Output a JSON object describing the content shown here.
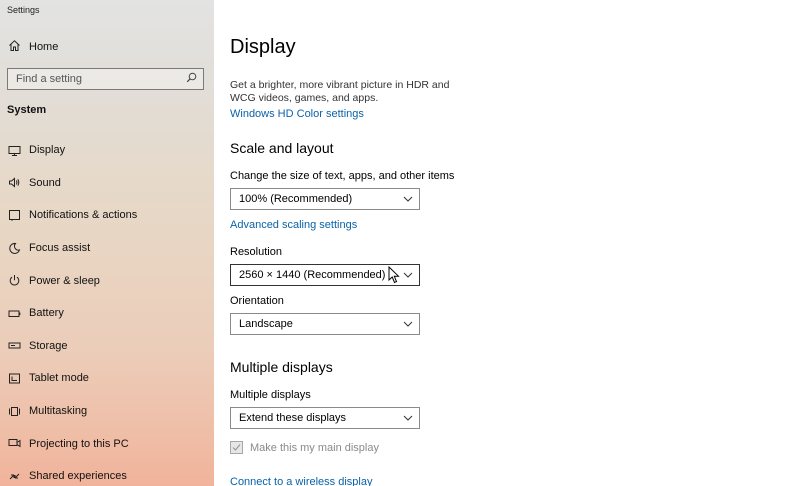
{
  "window": {
    "title": "Settings"
  },
  "sidebar": {
    "home_label": "Home",
    "search_placeholder": "Find a setting",
    "section_title": "System",
    "items": [
      {
        "label": "Display",
        "icon": "monitor-icon"
      },
      {
        "label": "Sound",
        "icon": "speaker-icon"
      },
      {
        "label": "Notifications & actions",
        "icon": "notification-icon"
      },
      {
        "label": "Focus assist",
        "icon": "moon-icon"
      },
      {
        "label": "Power & sleep",
        "icon": "power-icon"
      },
      {
        "label": "Battery",
        "icon": "battery-icon"
      },
      {
        "label": "Storage",
        "icon": "storage-icon"
      },
      {
        "label": "Tablet mode",
        "icon": "tablet-icon"
      },
      {
        "label": "Multitasking",
        "icon": "multitasking-icon"
      },
      {
        "label": "Projecting to this PC",
        "icon": "projecting-icon"
      },
      {
        "label": "Shared experiences",
        "icon": "shared-experiences-icon"
      }
    ]
  },
  "main": {
    "title": "Display",
    "description": "Get a brighter, more vibrant picture in HDR and WCG videos, games, and apps.",
    "hd_color_link": "Windows HD Color settings",
    "scale_layout": {
      "heading": "Scale and layout",
      "size_label": "Change the size of text, apps, and other items",
      "size_value": "100% (Recommended)",
      "advanced_link": "Advanced scaling settings",
      "resolution_label": "Resolution",
      "resolution_value": "2560 × 1440 (Recommended)",
      "orientation_label": "Orientation",
      "orientation_value": "Landscape"
    },
    "multiple_displays": {
      "heading": "Multiple displays",
      "label": "Multiple displays",
      "value": "Extend these displays",
      "main_display_checkbox": "Make this my main display",
      "wireless_link": "Connect to a wireless display"
    }
  },
  "colors": {
    "link": "#0a62a8",
    "sidebar_top": "#e3e3e3",
    "sidebar_bottom": "#f1b39b"
  }
}
